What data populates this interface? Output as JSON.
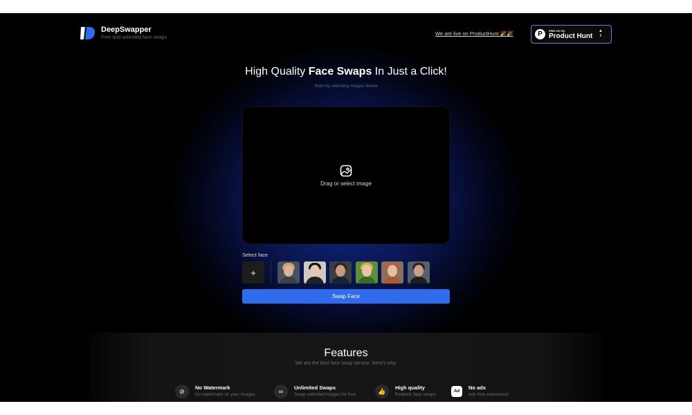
{
  "brand": {
    "name": "DeepSwapper",
    "tagline": "Free and unlimited face swaps",
    "accent": "#2f6bea"
  },
  "header": {
    "producthunt_link": "We are live on ProductHunt 🎉🎉",
    "badge": {
      "small_text": "FIND US ON",
      "title": "Product Hunt",
      "letter": "P",
      "arrow": "▲",
      "votes": "5"
    }
  },
  "hero": {
    "title_pre": "High Quality ",
    "title_bold": "Face Swaps",
    "title_post": " In Just a Click!",
    "subtitle": "Start by selecting images below"
  },
  "dropzone": {
    "label": "Drag or select image",
    "icon": "image-icon"
  },
  "faces": {
    "label": "Select face",
    "add_label": "+",
    "options": [
      {
        "bg": "#4a5160",
        "skin": "#d9b39a",
        "hair": "#c9a36b",
        "cloth": "#3a3f48"
      },
      {
        "bg": "#cfc9c4",
        "skin": "#e6c7b2",
        "hair": "#1b1514",
        "cloth": "#222"
      },
      {
        "bg": "#3b3f45",
        "skin": "#c89a80",
        "hair": "#2a2420",
        "cloth": "#1a2330"
      },
      {
        "bg": "#5d8f3a",
        "skin": "#e8c5a6",
        "hair": "#e0a857",
        "cloth": "#3b6a28"
      },
      {
        "bg": "#8a6f5a",
        "skin": "#e3bfa4",
        "hair": "#b9603a",
        "cloth": "#a85a35"
      },
      {
        "bg": "#55606a",
        "skin": "#c9a085",
        "hair": "#2b2522",
        "cloth": "#1e1e1e"
      }
    ]
  },
  "swap_button": "Swap Face",
  "features": {
    "title": "Features",
    "subtitle": "We are the best face swap service. Here's why.",
    "items": [
      {
        "name": "No Watermark",
        "desc": "No watermark on your images",
        "icon": "no-symbol-icon",
        "glyph": "⊘"
      },
      {
        "name": "Unlimited Swaps",
        "desc": "Swap unlimited images for free",
        "icon": "infinity-icon",
        "glyph": "∞"
      },
      {
        "name": "High quality",
        "desc": "Realistic face swaps",
        "icon": "thumbs-up-icon",
        "glyph": "👍"
      },
      {
        "name": "No ads",
        "desc": "Ads free experience",
        "icon": "ad-icon",
        "glyph": "Ad"
      }
    ]
  }
}
